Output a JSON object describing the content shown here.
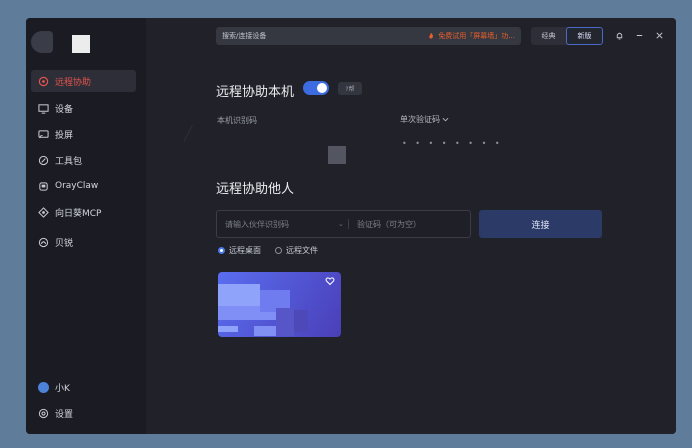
{
  "sidebar": {
    "items": [
      {
        "label": "远程协助",
        "icon": "remote-assist-icon",
        "active": true
      },
      {
        "label": "设备",
        "icon": "monitor-icon"
      },
      {
        "label": "投屏",
        "icon": "cast-icon"
      },
      {
        "label": "工具包",
        "icon": "toolbox-icon"
      },
      {
        "label": "OrayClaw",
        "icon": "claw-icon"
      },
      {
        "label": "向日葵MCP",
        "icon": "mcp-icon"
      },
      {
        "label": "贝锐",
        "icon": "oray-icon"
      }
    ],
    "user": {
      "label": "小K"
    },
    "settings": {
      "label": "设置"
    }
  },
  "topbar": {
    "search_text": "搜索/连接设备",
    "promo_text": "免费试用「屏幕墙」功...",
    "mode_classic": "经典",
    "mode_new": "新版"
  },
  "assist_self": {
    "title": "远程协助本机",
    "help_badge": "?帮",
    "code_label": "本机识别码",
    "verify_label": "单次验证码",
    "verify_value": "• • • • • • • •"
  },
  "assist_other": {
    "title": "远程协助他人",
    "partner_placeholder": "请输入伙伴识别码",
    "verify_placeholder": "验证码（可为空）",
    "connect_label": "连接",
    "radio_desktop": "远程桌面",
    "radio_file": "远程文件"
  },
  "colors": {
    "accent": "#3d6be0",
    "active_nav": "#e4544d",
    "promo": "#e8602c"
  }
}
